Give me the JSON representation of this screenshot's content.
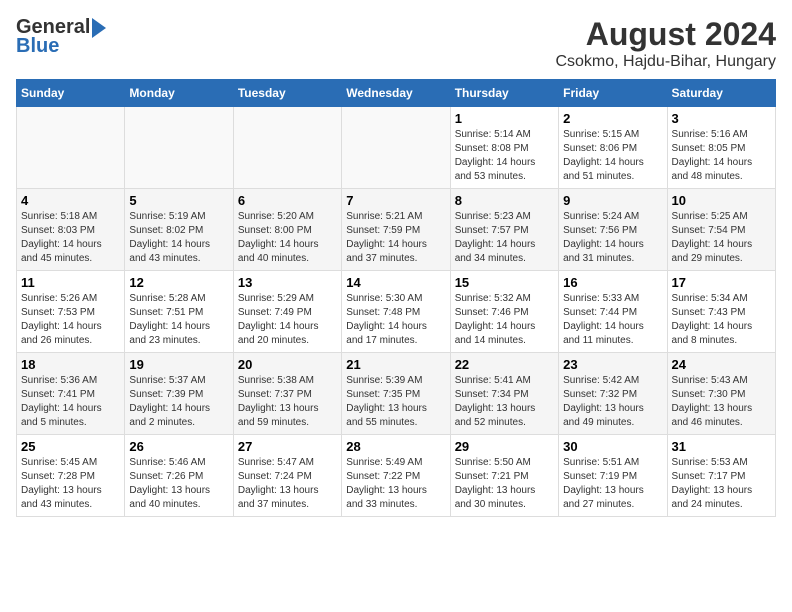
{
  "header": {
    "logo_general": "General",
    "logo_blue": "Blue",
    "title": "August 2024",
    "subtitle": "Csokmo, Hajdu-Bihar, Hungary"
  },
  "weekdays": [
    "Sunday",
    "Monday",
    "Tuesday",
    "Wednesday",
    "Thursday",
    "Friday",
    "Saturday"
  ],
  "weeks": [
    [
      {
        "day": "",
        "info": ""
      },
      {
        "day": "",
        "info": ""
      },
      {
        "day": "",
        "info": ""
      },
      {
        "day": "",
        "info": ""
      },
      {
        "day": "1",
        "info": "Sunrise: 5:14 AM\nSunset: 8:08 PM\nDaylight: 14 hours\nand 53 minutes."
      },
      {
        "day": "2",
        "info": "Sunrise: 5:15 AM\nSunset: 8:06 PM\nDaylight: 14 hours\nand 51 minutes."
      },
      {
        "day": "3",
        "info": "Sunrise: 5:16 AM\nSunset: 8:05 PM\nDaylight: 14 hours\nand 48 minutes."
      }
    ],
    [
      {
        "day": "4",
        "info": "Sunrise: 5:18 AM\nSunset: 8:03 PM\nDaylight: 14 hours\nand 45 minutes."
      },
      {
        "day": "5",
        "info": "Sunrise: 5:19 AM\nSunset: 8:02 PM\nDaylight: 14 hours\nand 43 minutes."
      },
      {
        "day": "6",
        "info": "Sunrise: 5:20 AM\nSunset: 8:00 PM\nDaylight: 14 hours\nand 40 minutes."
      },
      {
        "day": "7",
        "info": "Sunrise: 5:21 AM\nSunset: 7:59 PM\nDaylight: 14 hours\nand 37 minutes."
      },
      {
        "day": "8",
        "info": "Sunrise: 5:23 AM\nSunset: 7:57 PM\nDaylight: 14 hours\nand 34 minutes."
      },
      {
        "day": "9",
        "info": "Sunrise: 5:24 AM\nSunset: 7:56 PM\nDaylight: 14 hours\nand 31 minutes."
      },
      {
        "day": "10",
        "info": "Sunrise: 5:25 AM\nSunset: 7:54 PM\nDaylight: 14 hours\nand 29 minutes."
      }
    ],
    [
      {
        "day": "11",
        "info": "Sunrise: 5:26 AM\nSunset: 7:53 PM\nDaylight: 14 hours\nand 26 minutes."
      },
      {
        "day": "12",
        "info": "Sunrise: 5:28 AM\nSunset: 7:51 PM\nDaylight: 14 hours\nand 23 minutes."
      },
      {
        "day": "13",
        "info": "Sunrise: 5:29 AM\nSunset: 7:49 PM\nDaylight: 14 hours\nand 20 minutes."
      },
      {
        "day": "14",
        "info": "Sunrise: 5:30 AM\nSunset: 7:48 PM\nDaylight: 14 hours\nand 17 minutes."
      },
      {
        "day": "15",
        "info": "Sunrise: 5:32 AM\nSunset: 7:46 PM\nDaylight: 14 hours\nand 14 minutes."
      },
      {
        "day": "16",
        "info": "Sunrise: 5:33 AM\nSunset: 7:44 PM\nDaylight: 14 hours\nand 11 minutes."
      },
      {
        "day": "17",
        "info": "Sunrise: 5:34 AM\nSunset: 7:43 PM\nDaylight: 14 hours\nand 8 minutes."
      }
    ],
    [
      {
        "day": "18",
        "info": "Sunrise: 5:36 AM\nSunset: 7:41 PM\nDaylight: 14 hours\nand 5 minutes."
      },
      {
        "day": "19",
        "info": "Sunrise: 5:37 AM\nSunset: 7:39 PM\nDaylight: 14 hours\nand 2 minutes."
      },
      {
        "day": "20",
        "info": "Sunrise: 5:38 AM\nSunset: 7:37 PM\nDaylight: 13 hours\nand 59 minutes."
      },
      {
        "day": "21",
        "info": "Sunrise: 5:39 AM\nSunset: 7:35 PM\nDaylight: 13 hours\nand 55 minutes."
      },
      {
        "day": "22",
        "info": "Sunrise: 5:41 AM\nSunset: 7:34 PM\nDaylight: 13 hours\nand 52 minutes."
      },
      {
        "day": "23",
        "info": "Sunrise: 5:42 AM\nSunset: 7:32 PM\nDaylight: 13 hours\nand 49 minutes."
      },
      {
        "day": "24",
        "info": "Sunrise: 5:43 AM\nSunset: 7:30 PM\nDaylight: 13 hours\nand 46 minutes."
      }
    ],
    [
      {
        "day": "25",
        "info": "Sunrise: 5:45 AM\nSunset: 7:28 PM\nDaylight: 13 hours\nand 43 minutes."
      },
      {
        "day": "26",
        "info": "Sunrise: 5:46 AM\nSunset: 7:26 PM\nDaylight: 13 hours\nand 40 minutes."
      },
      {
        "day": "27",
        "info": "Sunrise: 5:47 AM\nSunset: 7:24 PM\nDaylight: 13 hours\nand 37 minutes."
      },
      {
        "day": "28",
        "info": "Sunrise: 5:49 AM\nSunset: 7:22 PM\nDaylight: 13 hours\nand 33 minutes."
      },
      {
        "day": "29",
        "info": "Sunrise: 5:50 AM\nSunset: 7:21 PM\nDaylight: 13 hours\nand 30 minutes."
      },
      {
        "day": "30",
        "info": "Sunrise: 5:51 AM\nSunset: 7:19 PM\nDaylight: 13 hours\nand 27 minutes."
      },
      {
        "day": "31",
        "info": "Sunrise: 5:53 AM\nSunset: 7:17 PM\nDaylight: 13 hours\nand 24 minutes."
      }
    ]
  ]
}
